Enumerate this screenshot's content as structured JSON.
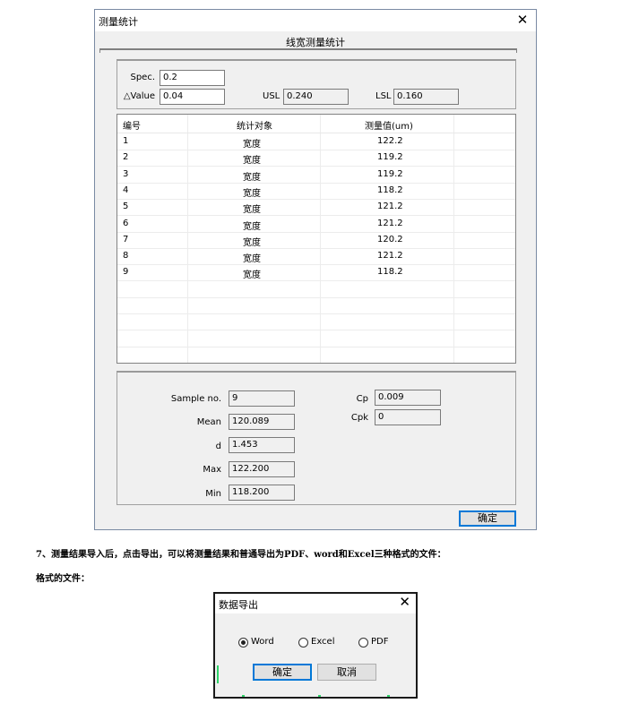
{
  "window": {
    "title": "测量统计",
    "heading": "线宽测量统计",
    "close_glyph": "✕"
  },
  "params": {
    "spec_label": "Spec.",
    "spec_value": "0.2",
    "dvalue_label": "△Value",
    "dvalue_value": "0.04",
    "usl_label": "USL",
    "usl_value": "0.240",
    "lsl_label": "LSL",
    "lsl_value": "0.160"
  },
  "table": {
    "columns": [
      "编号",
      "统计对象",
      "测量值(um)"
    ],
    "rows": [
      [
        "1",
        "宽度",
        "122.2"
      ],
      [
        "2",
        "宽度",
        "119.2"
      ],
      [
        "3",
        "宽度",
        "119.2"
      ],
      [
        "4",
        "宽度",
        "118.2"
      ],
      [
        "5",
        "宽度",
        "121.2"
      ],
      [
        "6",
        "宽度",
        "121.2"
      ],
      [
        "7",
        "宽度",
        "120.2"
      ],
      [
        "8",
        "宽度",
        "121.2"
      ],
      [
        "9",
        "宽度",
        "118.2"
      ]
    ]
  },
  "stats": {
    "sample_label": "Sample no.",
    "sample_value": "9",
    "mean_label": "Mean",
    "mean_value": "120.089",
    "d_label": "d",
    "d_value": "1.453",
    "max_label": "Max",
    "max_value": "122.200",
    "min_label": "Min",
    "min_value": "118.200",
    "cp_label": "Cp",
    "cp_value": "0.009",
    "cpk_label": "Cpk",
    "cpk_value": "0"
  },
  "ok_button": "确定",
  "caption_line1": "7、测量结果导入后，点击导出，可以将测量结果和普通导出为PDF、word和Excel三种格式的文件：",
  "caption_line2": "格式的文件：",
  "export_dialog": {
    "title": "数据导出",
    "close_glyph": "✕",
    "options": [
      "Word",
      "Excel",
      "PDF"
    ],
    "selected": "Word",
    "confirm": "确定",
    "cancel": "取消"
  }
}
